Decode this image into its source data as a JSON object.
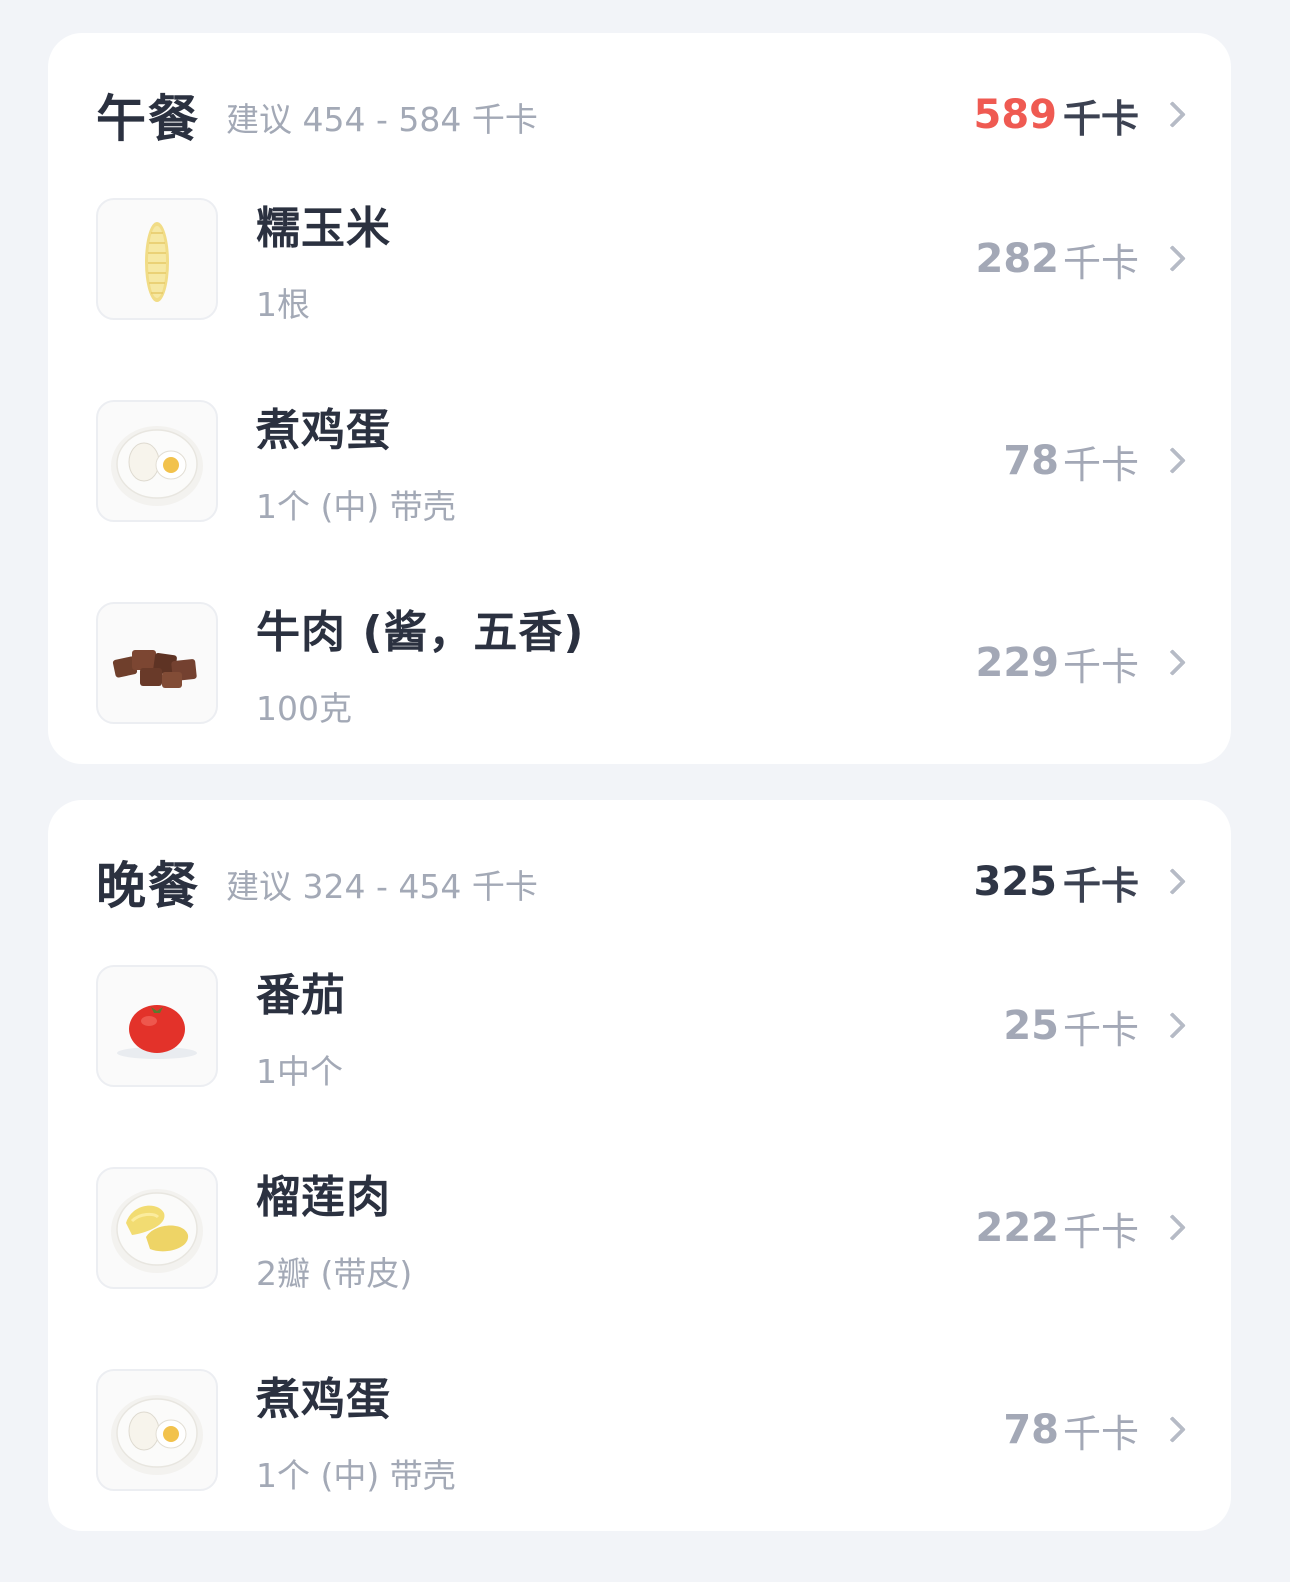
{
  "lunch": {
    "title": "午餐",
    "suggest": "建议 454 - 584 千卡",
    "total_value": "589",
    "total_unit": "千卡",
    "total_color": "#ef5a52",
    "items": [
      {
        "name": "糯玉米",
        "qty": "1根",
        "kcal": "282",
        "unit": "千卡",
        "icon": "corn-icon"
      },
      {
        "name": "煮鸡蛋",
        "qty": "1个 (中) 带壳",
        "kcal": "78",
        "unit": "千卡",
        "icon": "boiled-egg-icon"
      },
      {
        "name": "牛肉 (酱，五香)",
        "qty": "100克",
        "kcal": "229",
        "unit": "千卡",
        "icon": "beef-icon"
      }
    ]
  },
  "dinner": {
    "title": "晚餐",
    "suggest": "建议 324 - 454 千卡",
    "total_value": "325",
    "total_unit": "千卡",
    "items": [
      {
        "name": "番茄",
        "qty": "1中个",
        "kcal": "25",
        "unit": "千卡",
        "icon": "tomato-icon"
      },
      {
        "name": "榴莲肉",
        "qty": "2瓣 (带皮)",
        "kcal": "222",
        "unit": "千卡",
        "icon": "durian-icon"
      },
      {
        "name": "煮鸡蛋",
        "qty": "1个 (中) 带壳",
        "kcal": "78",
        "unit": "千卡",
        "icon": "boiled-egg-icon"
      }
    ]
  }
}
